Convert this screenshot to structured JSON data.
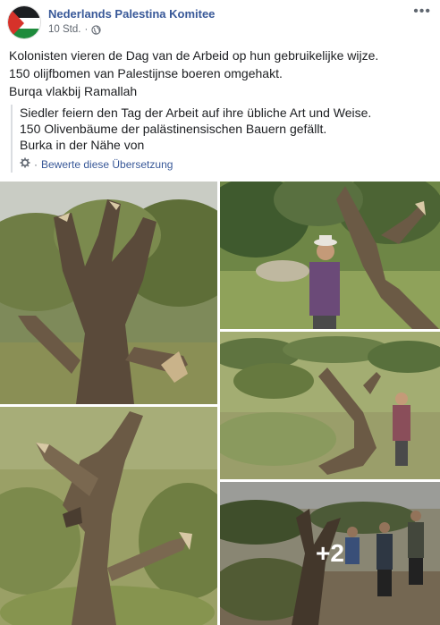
{
  "post": {
    "page_name": "Nederlands Palestina Komitee",
    "timestamp": "10 Std.",
    "audience_icon": "globe-icon",
    "more_icon": "ellipsis-icon",
    "more_label": "•••",
    "dot": "·",
    "text_lines": [
      "Kolonisten vieren de Dag van de Arbeid op hun gebruikelijke wijze.",
      "150 olijfbomen van Palestijnse boeren omgehakt.",
      "Burqa vlakbij Ramallah"
    ]
  },
  "translation": {
    "lines": [
      "Siedler feiern den Tag der Arbeit auf ihre übliche Art und Weise.",
      "150 Olivenbäume der palästinensischen Bauern gefällt.",
      "Burka in der Nähe von"
    ],
    "rate_icon": "gear-icon",
    "separator": "·",
    "rate_label": "Bewerte diese Übersetzung"
  },
  "gallery": {
    "photo_count": 5,
    "more_overlay_label": "+2"
  },
  "colors": {
    "link": "#385898",
    "secondary_text": "#606770",
    "text": "#1c1e21",
    "flag_red": "#d6322a",
    "flag_green": "#1e8b3c"
  }
}
